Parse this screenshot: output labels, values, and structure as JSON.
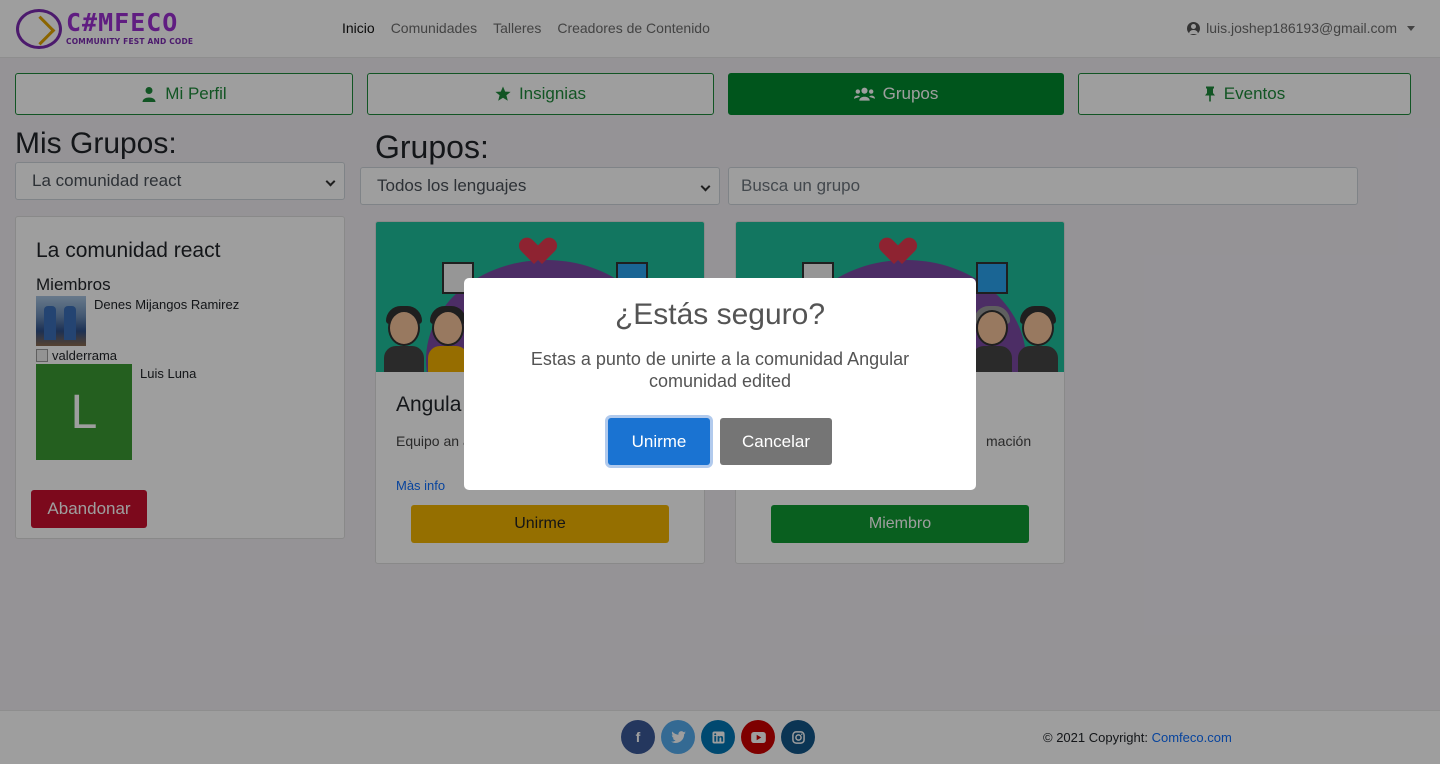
{
  "brand": {
    "title": "C#MFECO",
    "subtitle": "COMMUNITY FEST AND CODE"
  },
  "nav": {
    "links": [
      "Inicio",
      "Comunidades",
      "Talleres",
      "Creadores de Contenido"
    ],
    "user_email": "luis.joshep186193@gmail.com"
  },
  "tabs": [
    {
      "label": "Mi Perfil",
      "icon": "user-icon"
    },
    {
      "label": "Insignias",
      "icon": "star-icon"
    },
    {
      "label": "Grupos",
      "icon": "users-icon",
      "active": true
    },
    {
      "label": "Eventos",
      "icon": "pin-icon"
    }
  ],
  "left": {
    "heading": "Mis Grupos:",
    "select_value": "La comunidad react",
    "card_title": "La comunidad react",
    "members_label": "Miembros",
    "members": [
      "Denes Mijangos Ramirez",
      "valderrama",
      "Luis Luna"
    ],
    "avatar_letter": "L",
    "leave_button": "Abandonar"
  },
  "main": {
    "heading": "Grupos:",
    "language_select": "Todos los lenguajes",
    "search_placeholder": "Busca un grupo",
    "cards": [
      {
        "title": "Angula",
        "desc": "Equipo an ayuda sol",
        "link": "Màs info",
        "button": "Unirme"
      },
      {
        "title": "",
        "desc": "mación",
        "link": "",
        "button": "Miembro"
      }
    ]
  },
  "modal": {
    "title": "¿Estás seguro?",
    "text": "Estas a punto de unirte a la comunidad Angular comunidad edited",
    "confirm": "Unirme",
    "cancel": "Cancelar"
  },
  "footer": {
    "socials": [
      "facebook-icon",
      "twitter-icon",
      "linkedin-icon",
      "youtube-icon",
      "instagram-icon"
    ],
    "copyright_prefix": "© 2021 Copyright:",
    "copyright_link": "Comfeco.com"
  },
  "colors": {
    "green": "#008a2e",
    "danger": "#c8102e",
    "warning": "#f0b400",
    "primary": "#1a73d2",
    "facebook": "#3b5998",
    "twitter": "#55acee",
    "linkedin": "#0077b5",
    "youtube": "#cc0000",
    "instagram": "#125688"
  }
}
